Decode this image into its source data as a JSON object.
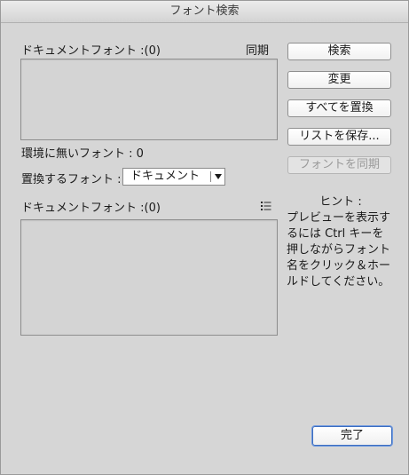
{
  "window": {
    "title": "フォント検索"
  },
  "doc_fonts_top": {
    "label": "ドキュメントフォント :(0)",
    "sync_label": "同期"
  },
  "missing": {
    "label": "環境に無いフォント : 0"
  },
  "replace": {
    "label": "置換するフォント :",
    "selected": "ドキュメント"
  },
  "doc_fonts_bottom": {
    "label": "ドキュメントフォント :(0)",
    "menu_icon": "list-menu-icon"
  },
  "buttons": {
    "find": "検索",
    "change": "変更",
    "change_all": "すべてを置換",
    "save_list": "リストを保存...",
    "sync_font": "フォントを同期",
    "done": "完了"
  },
  "hint": {
    "title": "ヒント :",
    "body": "プレビューを表示するには Ctrl キーを押しながらフォント名をクリック＆ホールドしてください。"
  },
  "colors": {
    "window_bg": "#d6d6d6",
    "default_button_border": "#3d6ec0",
    "disabled_text": "#9a9a9a"
  }
}
